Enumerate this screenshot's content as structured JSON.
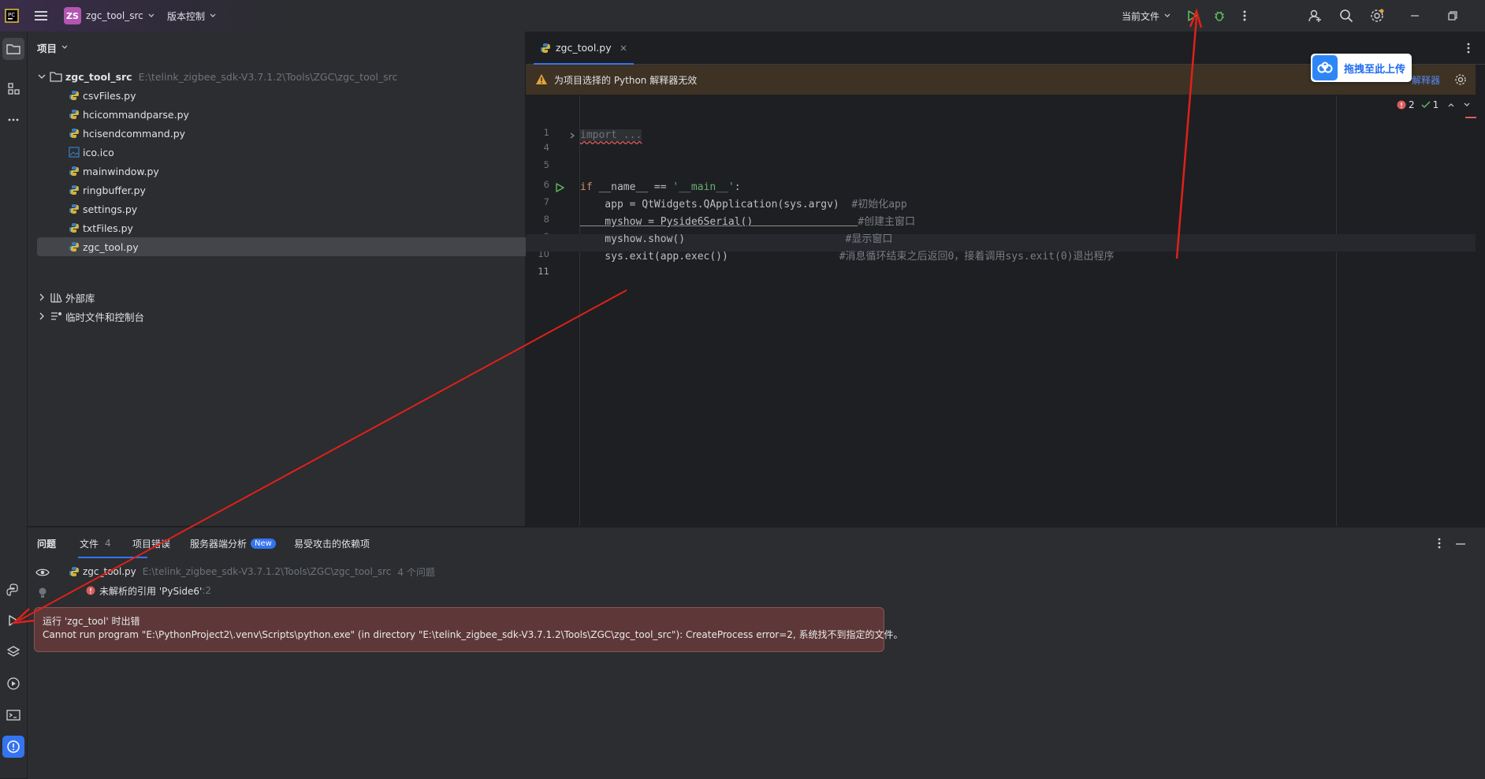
{
  "titlebar": {
    "project_badge": "ZS",
    "project_name": "zgc_tool_src",
    "vcs_label": "版本控制",
    "run_config": "当前文件"
  },
  "project_panel": {
    "title": "项目",
    "root": {
      "name": "zgc_tool_src",
      "path": "E:\\telink_zigbee_sdk-V3.7.1.2\\Tools\\ZGC\\zgc_tool_src"
    },
    "files": [
      "csvFiles.py",
      "hcicommandparse.py",
      "hcisendcommand.py",
      "ico.ico",
      "mainwindow.py",
      "ringbuffer.py",
      "settings.py",
      "txtFiles.py",
      "zgc_tool.py"
    ],
    "external_libs": "外部库",
    "scratches": "临时文件和控制台"
  },
  "editor": {
    "tab_label": "zgc_tool.py",
    "warning_text": "为项目选择的 Python 解释器无效",
    "warning_action": "解释器",
    "inspection": {
      "errors": "2",
      "ok": "1"
    },
    "line_numbers": [
      "1",
      "4",
      "5",
      "6",
      "7",
      "8",
      "9",
      "10",
      "11"
    ],
    "code": {
      "l1": "import ...",
      "l6_kw": "if",
      "l6_a": " __name__ == ",
      "l6_str": "'__main__'",
      "l6_b": ":",
      "l7": "    app = QtWidgets.QApplication(sys.argv)  ",
      "l7_cmt": "#初始化app",
      "l8": "    myshow = Pyside6Serial()                 ",
      "l8_cmt": "#创建主窗口",
      "l9": "    myshow.show()                          ",
      "l9_cmt": "#显示窗口",
      "l10": "    sys.exit(app.exec())                  ",
      "l10_cmt": "#消息循环结束之后返回0，接着调用sys.exit(0)退出程序"
    }
  },
  "bottom_panel": {
    "tabs": [
      "问题",
      "文件",
      "项目错误",
      "服务器端分析",
      "易受攻击的依赖项"
    ],
    "files_count": "4",
    "new_badge": "New",
    "problem_file": "zgc_tool.py",
    "problem_path": "E:\\telink_zigbee_sdk-V3.7.1.2\\Tools\\ZGC\\zgc_tool_src",
    "problem_count": "4 个问题",
    "problem_1": "未解析的引用 'PySide6'",
    "problem_1_loc": ":2"
  },
  "error_popup": {
    "title": "运行 'zgc_tool' 时出错",
    "message": "Cannot run program \"E:\\PythonProject2\\.venv\\Scripts\\python.exe\" (in directory \"E:\\telink_zigbee_sdk-V3.7.1.2\\Tools\\ZGC\\zgc_tool_src\"): CreateProcess error=2, 系统找不到指定的文件。"
  },
  "upload_widget": {
    "label": "拖拽至此上传"
  },
  "colors": {
    "accent": "#3574f0",
    "error": "#db5c5c",
    "run_green": "#5fb865",
    "annotation_red": "#e0201a"
  }
}
